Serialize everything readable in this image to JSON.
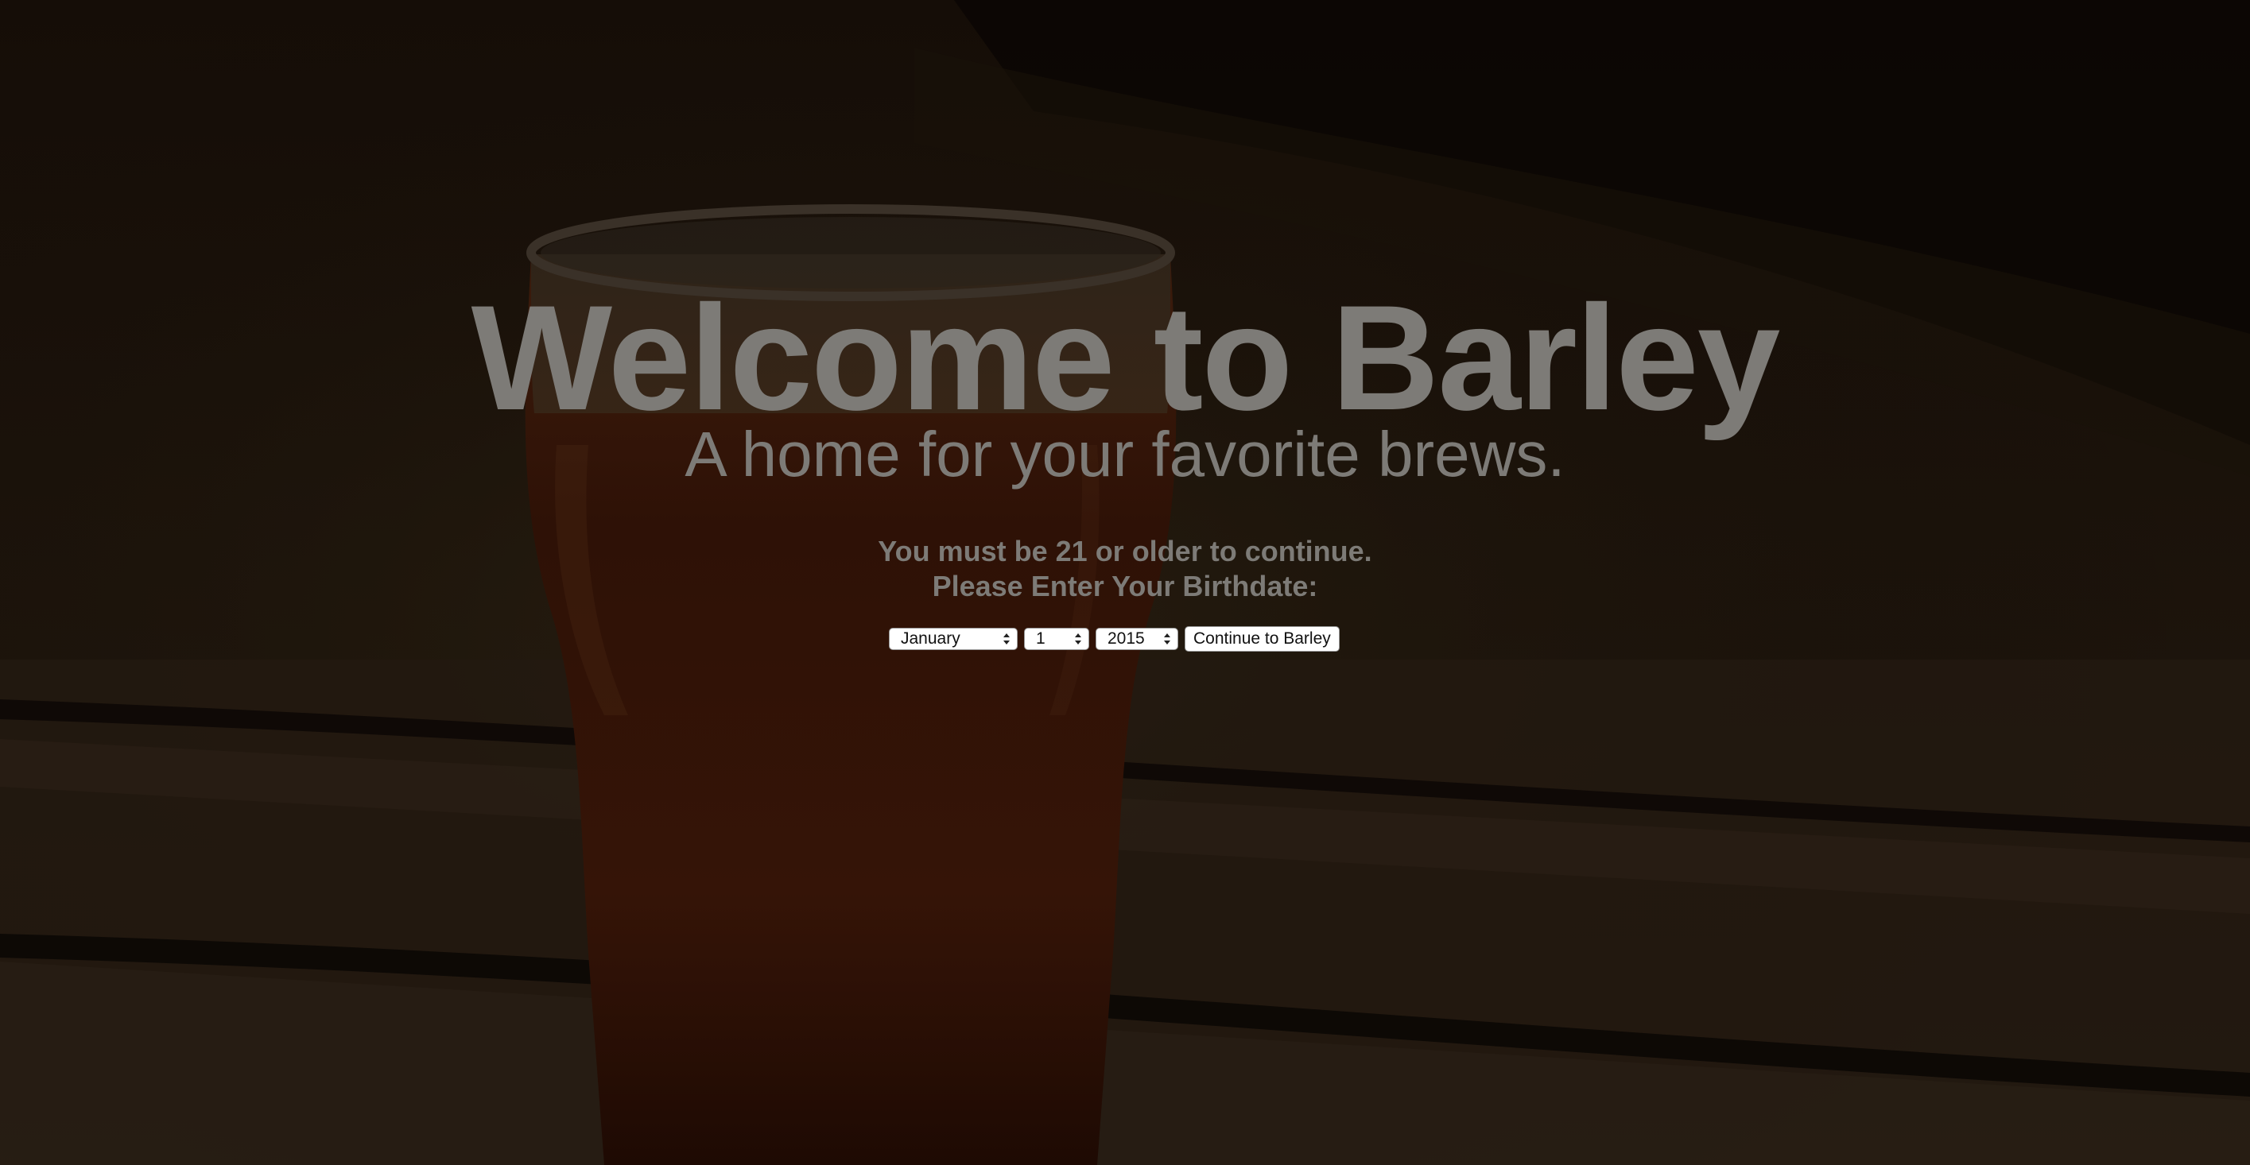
{
  "hero": {
    "title": "Welcome to Barley",
    "subtitle": "A home for your favorite brews."
  },
  "age_gate": {
    "notice_line1": "You must be 21 or older to continue.",
    "notice_line2": "Please Enter Your Birthdate:",
    "month_value": "January",
    "day_value": "1",
    "year_value": "2015",
    "continue_label": "Continue to Barley"
  },
  "colors": {
    "text": "#7d7b77",
    "background": "#1c140c",
    "beer": "#3a1406"
  },
  "background_image": "pint-of-beer-on-wooden-table"
}
